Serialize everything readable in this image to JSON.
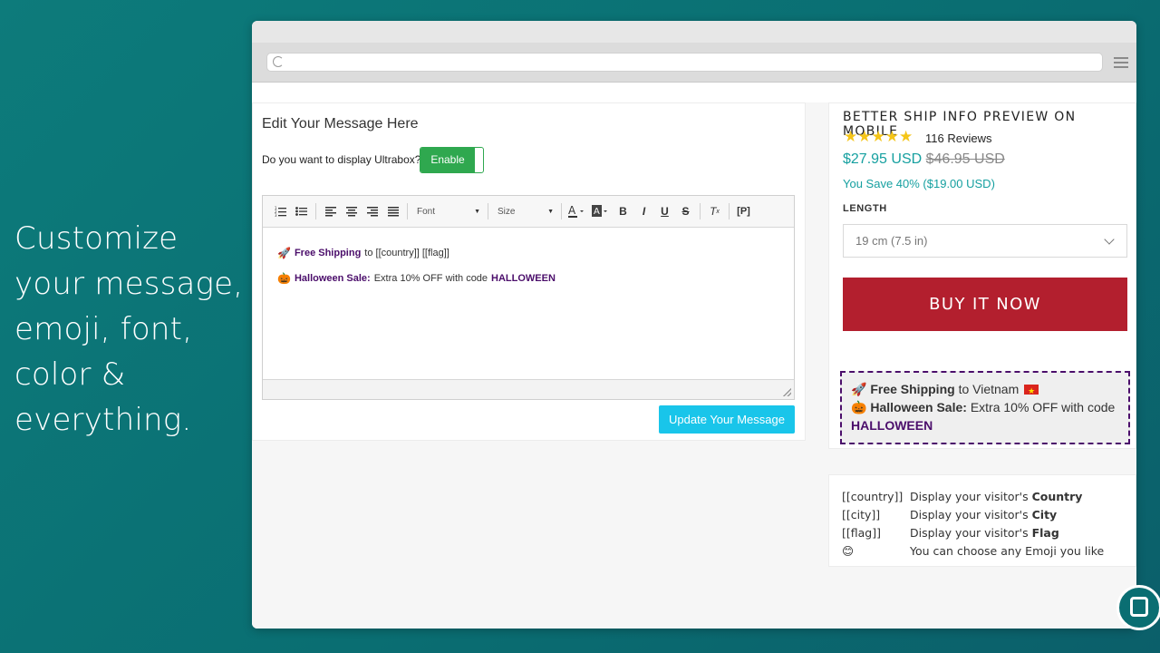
{
  "tagline": "Customize your message, emoji, font, color & everything.",
  "editor": {
    "title": "Edit Your Message Here",
    "display_question": "Do you want to display Ultrabox?",
    "toggle_label": "Enable",
    "toolbar": {
      "font_label": "Font",
      "size_label": "Size"
    },
    "lines": [
      {
        "emoji": "🚀",
        "bold": "Free Shipping",
        "rest": "to [[country]] [[flag]]",
        "code": ""
      },
      {
        "emoji": "🎃",
        "bold": "Halloween Sale:",
        "rest": "Extra 10% OFF with code",
        "code": "HALLOWEEN"
      }
    ],
    "update_label": "Update Your Message"
  },
  "product": {
    "title": "Better Ship Info Preview On Mobile",
    "stars": "★★★★★",
    "reviews": "116 Reviews",
    "price": "$27.95 USD",
    "old_price": "$46.95 USD",
    "save_text": "You Save 40% ($19.00 USD)",
    "length_label": "LENGTH",
    "length_value": "19 cm (7.5 in)",
    "buy_label": "BUY IT NOW"
  },
  "preview": {
    "line1_emoji": "🚀",
    "line1_bold": "Free Shipping",
    "line1_rest": "to Vietnam",
    "line2_emoji": "🎃",
    "line2_bold": "Halloween Sale:",
    "line2_rest": "Extra 10% OFF with code",
    "line2_code": "HALLOWEEN"
  },
  "legend": [
    {
      "key": "[[country]]",
      "desc": "Display your visitor's",
      "strong": "Country"
    },
    {
      "key": "[[city]]",
      "desc": "Display your visitor's",
      "strong": "City"
    },
    {
      "key": "[[flag]]",
      "desc": "Display your visitor's",
      "strong": "Flag"
    },
    {
      "key": "😊",
      "desc": "You can choose any Emoji you like",
      "strong": ""
    }
  ],
  "colors": {
    "accent_green": "#2fa84f",
    "button_cyan": "#19c5ea",
    "buy_red": "#b31f2e",
    "price_teal": "#16a0a0",
    "code_purple": "#4b0e6b"
  }
}
